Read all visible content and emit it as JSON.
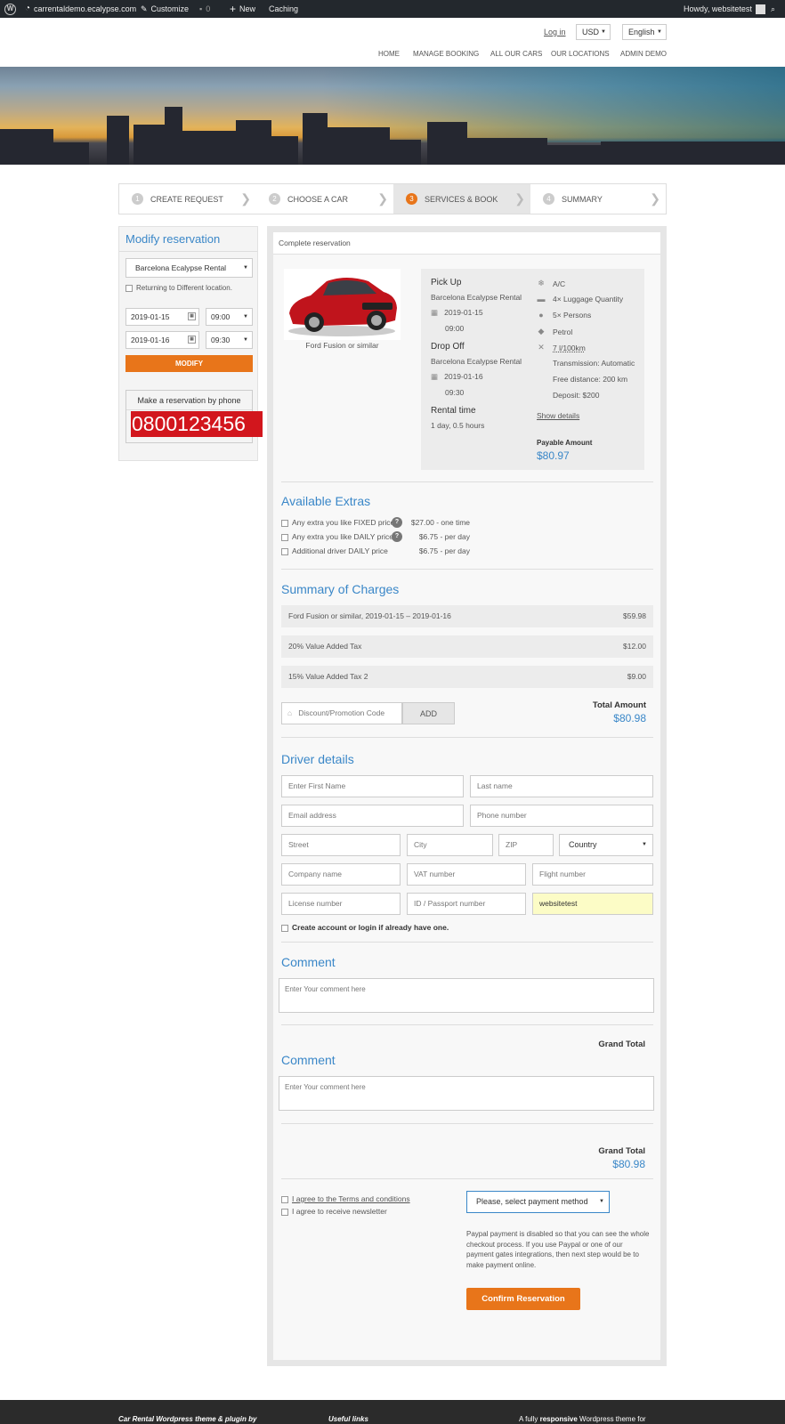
{
  "admin_bar": {
    "site": "carrentaldemo.ecalypse.com",
    "customize": "Customize",
    "comments_count": "0",
    "new": "New",
    "caching": "Caching",
    "howdy": "Howdy, websitetest"
  },
  "header": {
    "login": "Log in",
    "currency": "USD",
    "language": "English",
    "nav": [
      "HOME",
      "MANAGE BOOKING",
      "ALL OUR CARS",
      "OUR LOCATIONS",
      "ADMIN DEMO"
    ]
  },
  "steps": [
    {
      "num": "1",
      "label": "CREATE REQUEST"
    },
    {
      "num": "2",
      "label": "CHOOSE A CAR"
    },
    {
      "num": "3",
      "label": "SERVICES & BOOK"
    },
    {
      "num": "4",
      "label": "SUMMARY"
    }
  ],
  "sidebar": {
    "title": "Modify reservation",
    "location": "Barcelona Ecalypse Rental",
    "return_label": "Returning to Different location.",
    "pickup_date": "2019-01-15",
    "pickup_time": "09:00",
    "dropoff_date": "2019-01-16",
    "dropoff_time": "09:30",
    "modify": "MODIFY",
    "phone_title": "Make a reservation by phone",
    "phone": "0800123456"
  },
  "main": {
    "breadcrumb": "Complete reservation",
    "car_name": "Ford Fusion or similar",
    "pickup": {
      "title": "Pick Up",
      "location": "Barcelona Ecalypse Rental",
      "date": "2019-01-15",
      "time": "09:00"
    },
    "dropoff": {
      "title": "Drop Off",
      "location": "Barcelona Ecalypse Rental",
      "date": "2019-01-16",
      "time": "09:30"
    },
    "rental_time": {
      "title": "Rental time",
      "value": "1 day, 0.5 hours"
    },
    "specs": [
      "A/C",
      "4× Luggage Quantity",
      "5× Persons",
      "Petrol",
      "7 l/100km",
      "Transmission: Automatic",
      "Free distance: 200 km",
      "Deposit: $200"
    ],
    "show_details": "Show details",
    "payable_label": "Payable Amount",
    "payable_amount": "$80.97",
    "extras": {
      "title": "Available Extras",
      "items": [
        {
          "label": "Any extra you like FIXED price",
          "price": "$27.00 - one time"
        },
        {
          "label": "Any extra you like DAILY price",
          "price": "$6.75 - per day"
        },
        {
          "label": "Additional driver DAILY price",
          "price": "$6.75 - per day"
        }
      ]
    },
    "charges": {
      "title": "Summary of Charges",
      "rows": [
        {
          "label": "Ford Fusion or similar, 2019-01-15 – 2019-01-16",
          "amount": "$59.98"
        },
        {
          "label": "20% Value Added Tax",
          "amount": "$12.00"
        },
        {
          "label": "15% Value Added Tax 2",
          "amount": "$9.00"
        }
      ],
      "promo_placeholder": "Discount/Promotion Code",
      "add": "ADD",
      "total_label": "Total Amount",
      "total": "$80.98"
    },
    "driver": {
      "title": "Driver details",
      "first_name": "Enter First Name",
      "last_name": "Last name",
      "email": "Email address",
      "phone": "Phone number",
      "street": "Street",
      "city": "City",
      "zip": "ZIP",
      "country": "Country",
      "company": "Company name",
      "vat": "VAT number",
      "flight": "Flight number",
      "license": "License number",
      "passport": "ID / Passport number",
      "username": "websitetest",
      "create_account_bold": "Create account or login",
      "create_account_rest": " if already have one."
    },
    "comment1": {
      "title": "Comment",
      "placeholder": "Enter Your comment here"
    },
    "grand_total_label_1": "Grand Total",
    "comment2": {
      "title": "Comment",
      "placeholder": "Enter Your comment here"
    },
    "grand_total_label_2": "Grand Total",
    "grand_total": "$80.98",
    "terms": "I agree to the Terms and conditions",
    "newsletter": "I agree to receive newsletter",
    "payment_method": "Please, select payment method",
    "paypal_note": "Paypal payment is disabled so that you can see the whole checkout process. If you use Paypal or one of our payment gates integrations, then next step would be to make payment online.",
    "confirm": "Confirm Reservation"
  },
  "footer": {
    "col1": "Car Rental Wordpress theme & plugin by",
    "col2": "Useful links",
    "col3_pre": "A fully ",
    "col3_bold": "responsive",
    "col3_post": " Wordpress theme for"
  }
}
